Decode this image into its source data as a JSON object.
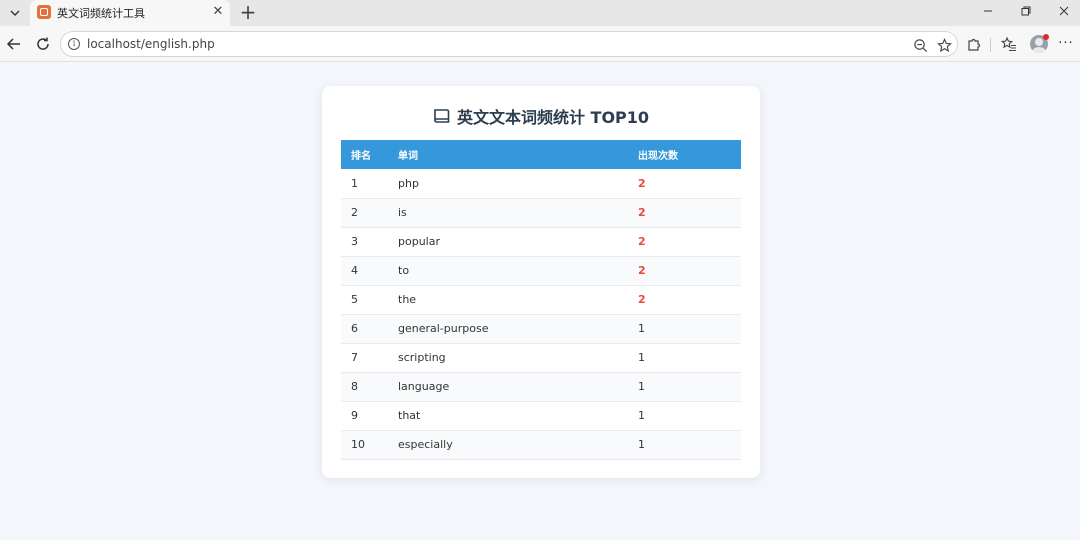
{
  "browser": {
    "tab_title": "英文词频统计工具",
    "tab_close": "✕",
    "new_tab": "+",
    "url": "localhost/english.php",
    "more": "···"
  },
  "page": {
    "title": "英文文本词频统计 TOP10",
    "headers": {
      "rank": "排名",
      "word": "单词",
      "count": "出现次数"
    },
    "rows": [
      {
        "rank": "1",
        "word": "php",
        "count": "2"
      },
      {
        "rank": "2",
        "word": "is",
        "count": "2"
      },
      {
        "rank": "3",
        "word": "popular",
        "count": "2"
      },
      {
        "rank": "4",
        "word": "to",
        "count": "2"
      },
      {
        "rank": "5",
        "word": "the",
        "count": "2"
      },
      {
        "rank": "6",
        "word": "general-purpose",
        "count": "1"
      },
      {
        "rank": "7",
        "word": "scripting",
        "count": "1"
      },
      {
        "rank": "8",
        "word": "language",
        "count": "1"
      },
      {
        "rank": "9",
        "word": "that",
        "count": "1"
      },
      {
        "rank": "10",
        "word": "especially",
        "count": "1"
      }
    ]
  },
  "colors": {
    "header_bg": "#3498db",
    "highlight_count": "#e74c3c",
    "page_bg": "#f3f6fb"
  }
}
